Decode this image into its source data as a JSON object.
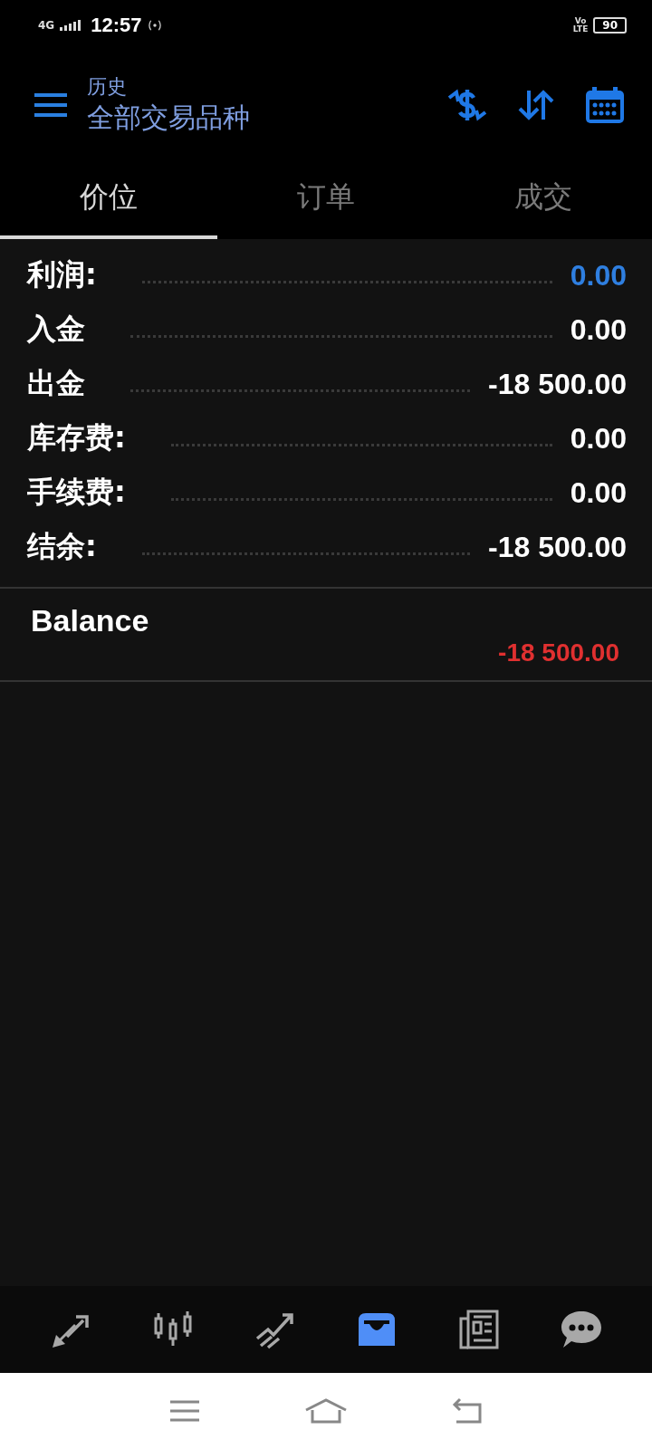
{
  "status_bar": {
    "network": "4G",
    "time": "12:57",
    "volte": "Vo",
    "lte": "LTE",
    "battery": "90"
  },
  "header": {
    "subtitle": "历史",
    "title": "全部交易品种"
  },
  "tabs": [
    {
      "label": "价位",
      "selected": true
    },
    {
      "label": "订单",
      "selected": false
    },
    {
      "label": "成交",
      "selected": false
    }
  ],
  "summary": [
    {
      "label": "利润:",
      "value": "0.00",
      "highlighted": true
    },
    {
      "label": "入金",
      "value": "0.00",
      "highlighted": false
    },
    {
      "label": "出金",
      "value": "-18 500.00",
      "highlighted": false
    },
    {
      "label": "库存费:",
      "value": "0.00",
      "highlighted": false
    },
    {
      "label": "手续费:",
      "value": "0.00",
      "highlighted": false
    },
    {
      "label": "结余:",
      "value": "-18 500.00",
      "highlighted": false
    }
  ],
  "deals": [
    {
      "title": "Balance",
      "amount": "-18 500.00"
    }
  ],
  "bottom_nav": [
    {
      "kind": "trade",
      "selected": false
    },
    {
      "kind": "chart",
      "selected": false
    },
    {
      "kind": "trend",
      "selected": false
    },
    {
      "kind": "history",
      "selected": true
    },
    {
      "kind": "news",
      "selected": false
    },
    {
      "kind": "chat",
      "selected": false
    }
  ]
}
